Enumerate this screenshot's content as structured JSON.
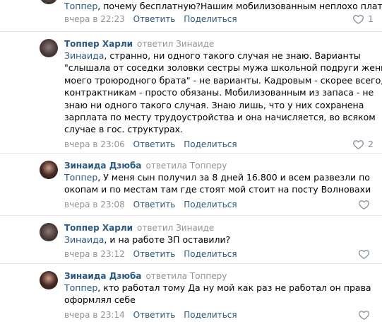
{
  "actions": {
    "reply": "Ответить",
    "share": "Поделиться"
  },
  "comments": [
    {
      "text": "Топпер, почему бесплатную?Нашим мобилизованным неплохо платят",
      "mention": "Топпер",
      "rest": ", почему бесплатную?Нашим мобилизованным неплохо платят",
      "date": "вчера в 22:23",
      "likes": "1"
    },
    {
      "author": "Топпер Харли",
      "replied": "ответил Зинаиде",
      "mention": "Зинаида",
      "lines": [
        ", странно, ни одного такого случая не знаю. Варианты",
        "\"слышала от соседки золовки сестры мужа школьной подруги жены",
        "моего троюродного брата\" - не варианты. Кадровым - скорее всего,",
        "контрактникам - просто обязаны. Мобилизованным из запаса - не",
        "знаю ни одного такого случая. Знаю лишь, что у них сохранена",
        "зарплата по месту трудоустройства и она начисляется, во всяком",
        "случае в гос. структурах."
      ],
      "date": "вчера в 23:06",
      "likes": "2"
    },
    {
      "author": "Зинаида Дзюба",
      "replied": "ответила Топперу",
      "mention": "Топпер",
      "lines": [
        ", У меня сын получил за 8 дней 16.800 и всем развезли по",
        "окопам и по местам там где стоят мой стоит на посту Волновахи"
      ],
      "date": "вчера в 23:08"
    },
    {
      "author": "Топпер Харли",
      "replied": "ответил Зинаиде",
      "mention": "Зинаида",
      "lines": [
        ", и на работе ЗП оставили?"
      ],
      "date": "вчера в 23:12"
    },
    {
      "author": "Зинаида Дзюба",
      "replied": "ответила Топперу",
      "mention": "Топпер",
      "lines": [
        ", кто работал тому Да ну мой как раз не работал он права",
        "оформлял себе"
      ],
      "date": "вчера в 23:14"
    }
  ]
}
